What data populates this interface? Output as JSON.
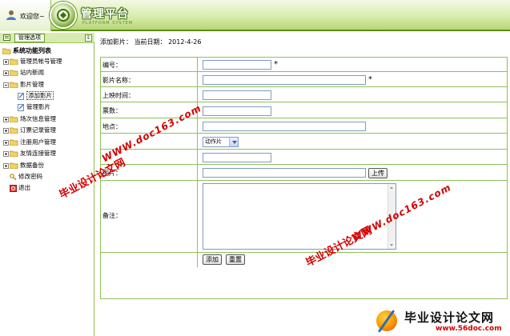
{
  "header": {
    "welcome": "欢迎您~",
    "brand_cn": "管理平台",
    "brand_en": "PLATFORM SYSTEM"
  },
  "sidebar": {
    "options_button": "管理选项",
    "collapse_icon": "double-arrow-down",
    "tree_title": "系统功能列表",
    "items": [
      {
        "label": "管理员帐号管理"
      },
      {
        "label": "站内新闻"
      },
      {
        "label": "影片管理"
      },
      {
        "label": "添加影片"
      },
      {
        "label": "管理影片"
      },
      {
        "label": "场次信息管理"
      },
      {
        "label": "订票记录管理"
      },
      {
        "label": "注册用户管理"
      },
      {
        "label": "友情连接管理"
      },
      {
        "label": "数据备份"
      },
      {
        "label": "修改密码"
      },
      {
        "label": "退出"
      }
    ]
  },
  "main": {
    "breadcrumb": "添加影片： 当前日期： 2012-4-26",
    "form": {
      "id_label": "编号：",
      "name_label": "影片名称：",
      "release_label": "上映时间：",
      "tickets_label": "票数：",
      "location_label": "地点：",
      "type_selected": "动作片",
      "image_label": "图片：",
      "upload_button": "上传",
      "remark_label": "备注：",
      "required_mark": "*",
      "submit_button": "添加",
      "reset_button": "重置"
    }
  },
  "watermarks": {
    "site_cn": "毕业设计论文网",
    "site_url": "WWW.doc163.com"
  },
  "footer": {
    "title": "毕业设计论文网",
    "url": "www.56doc.com"
  },
  "colors": {
    "accent_green": "#5b8d16",
    "border_green": "#90c05a",
    "watermark_red": "#d40000"
  }
}
